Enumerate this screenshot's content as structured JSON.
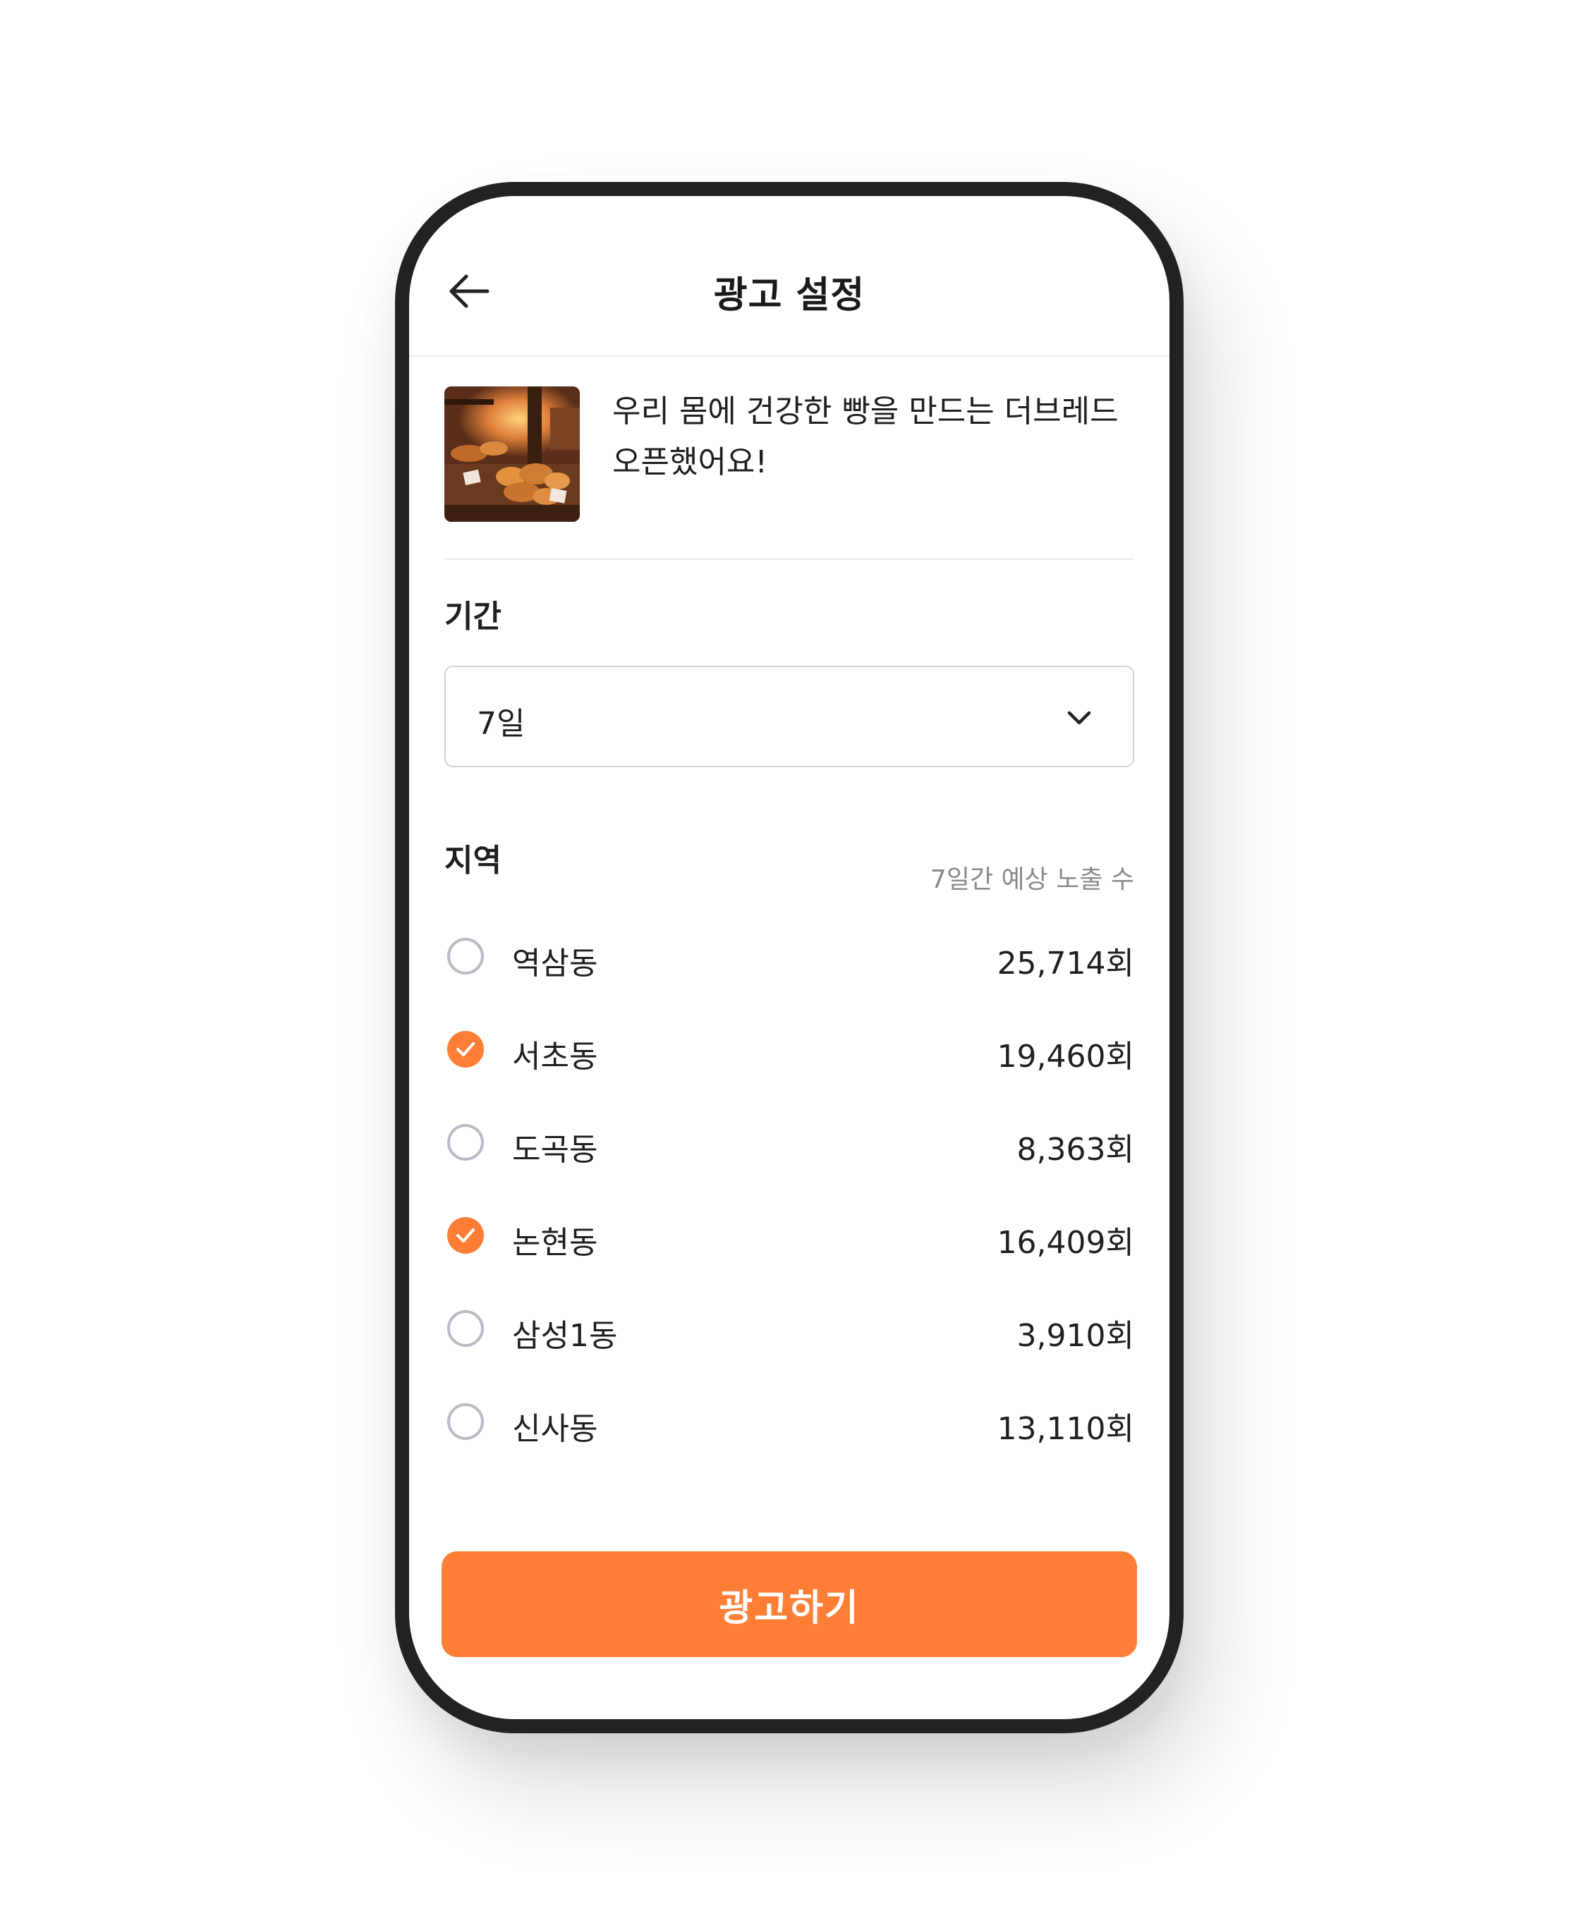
{
  "header": {
    "title": "광고 설정",
    "back_icon": "arrow-left-icon"
  },
  "ad": {
    "text": "우리 몸에 건강한 빵을 만드는 더브레드 오픈했어요!"
  },
  "period": {
    "label": "기간",
    "selected": "7일",
    "dropdown_icon": "chevron-down-icon"
  },
  "region": {
    "label": "지역",
    "exposure_header": "7일간 예상 노출 수",
    "items": [
      {
        "name": "역삼동",
        "count": "25,714회",
        "checked": false
      },
      {
        "name": "서초동",
        "count": "19,460회",
        "checked": true
      },
      {
        "name": "도곡동",
        "count": "8,363회",
        "checked": false
      },
      {
        "name": "논현동",
        "count": "16,409회",
        "checked": true
      },
      {
        "name": "삼성1동",
        "count": "3,910회",
        "checked": false
      },
      {
        "name": "신사동",
        "count": "13,110회",
        "checked": false
      }
    ]
  },
  "cta": {
    "label": "광고하기"
  },
  "colors": {
    "accent": "#ff7e36",
    "unchecked_border": "#b9bcc4",
    "divider": "#ececec"
  }
}
